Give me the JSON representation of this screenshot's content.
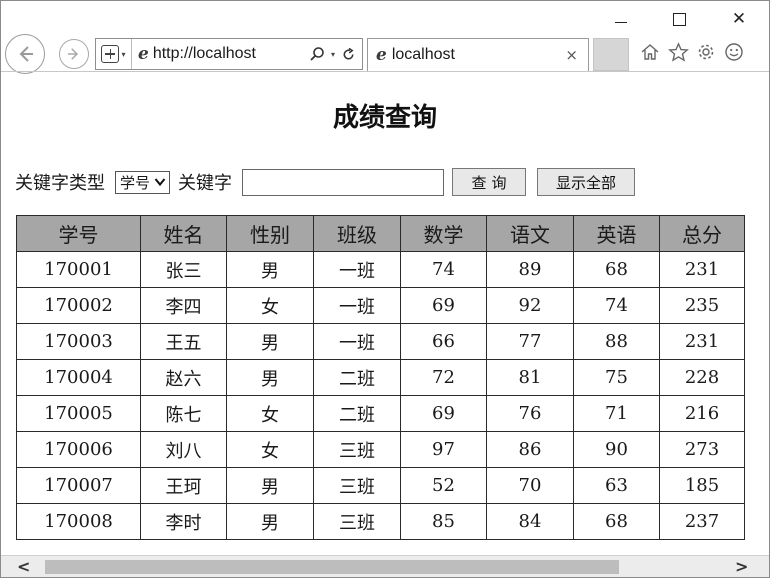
{
  "browser": {
    "url": "http://localhost",
    "tab_title": "localhost",
    "tab_close": "×",
    "close_glyph": "✕",
    "icons": [
      "back-icon",
      "forward-icon",
      "compatibility-icon",
      "ie-logo-icon",
      "search-icon",
      "dropdown-icon",
      "refresh-icon",
      "home-icon",
      "favorites-star-icon",
      "settings-gear-icon",
      "smiley-feedback-icon"
    ]
  },
  "page": {
    "title": "成绩查询"
  },
  "search": {
    "type_label": "关键字类型",
    "type_selected": "学号",
    "keyword_label": "关键字",
    "keyword_value": "",
    "query_button": "查询",
    "show_all_button": "显示全部"
  },
  "table": {
    "headers": [
      "学号",
      "姓名",
      "性别",
      "班级",
      "数学",
      "语文",
      "英语",
      "总分"
    ],
    "rows": [
      [
        "170001",
        "张三",
        "男",
        "一班",
        "74",
        "89",
        "68",
        "231"
      ],
      [
        "170002",
        "李四",
        "女",
        "一班",
        "69",
        "92",
        "74",
        "235"
      ],
      [
        "170003",
        "王五",
        "男",
        "一班",
        "66",
        "77",
        "88",
        "231"
      ],
      [
        "170004",
        "赵六",
        "男",
        "二班",
        "72",
        "81",
        "75",
        "228"
      ],
      [
        "170005",
        "陈七",
        "女",
        "二班",
        "69",
        "76",
        "71",
        "216"
      ],
      [
        "170006",
        "刘八",
        "女",
        "三班",
        "97",
        "86",
        "90",
        "273"
      ],
      [
        "170007",
        "王珂",
        "男",
        "三班",
        "52",
        "70",
        "63",
        "185"
      ],
      [
        "170008",
        "李时",
        "男",
        "三班",
        "85",
        "84",
        "68",
        "237"
      ]
    ]
  },
  "colors": {
    "header_bg": "#a6a6a6",
    "border": "#2a2a2a"
  }
}
